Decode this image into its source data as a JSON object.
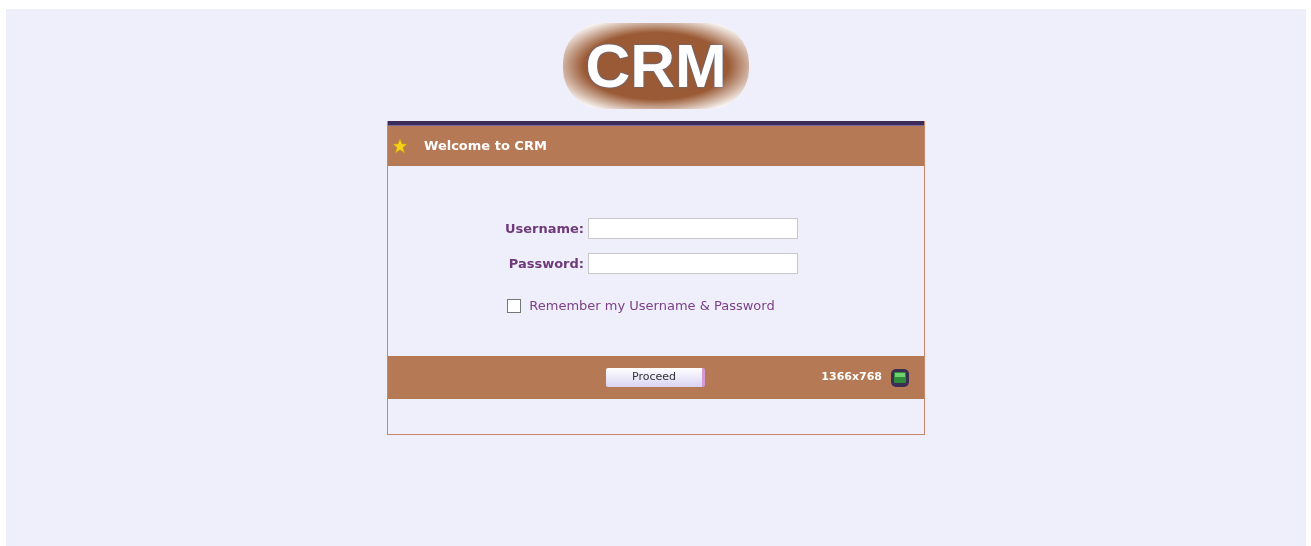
{
  "logo": {
    "text": "CRM"
  },
  "panel": {
    "title": "Welcome to CRM"
  },
  "fields": [
    {
      "label": "Username:"
    },
    {
      "label": "Password:"
    }
  ],
  "remember": {
    "label": "Remember my Username & Password",
    "checked": false
  },
  "footer": {
    "button": "Proceed",
    "resolution": "1366x768"
  }
}
